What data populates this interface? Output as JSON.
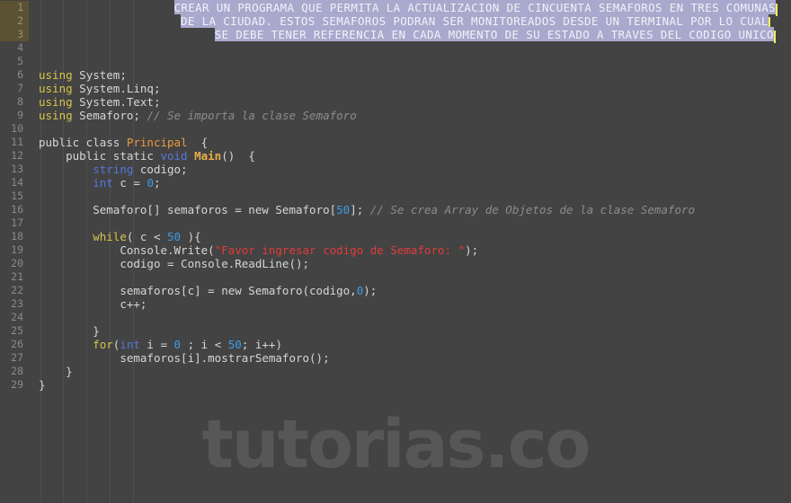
{
  "editor": {
    "background_color": "#434343",
    "gutter_color": "#8a8a8a",
    "highlight_line_bg": "#5b5233",
    "selection_bg": "#a9a8cd",
    "caret_color": "#f5f055",
    "watermark": "tutorias.co"
  },
  "gutter": {
    "numbers": [
      "1",
      "2",
      "3",
      "4",
      "5",
      "6",
      "7",
      "8",
      "9",
      "10",
      "11",
      "12",
      "13",
      "14",
      "15",
      "16",
      "17",
      "18",
      "19",
      "20",
      "21",
      "22",
      "23",
      "24",
      "25",
      "26",
      "27",
      "28",
      "29"
    ]
  },
  "prompt": {
    "line1": "CREAR UN PROGRAMA QUE PERMITA LA ACTUALIZACION DE CINCUENTA SEMAFOROS EN TRES COMUNAS",
    "line2": "DE LA CIUDAD. ESTOS SEMAFOROS PODRAN SER MONITOREADOS DESDE UN TERMINAL POR LO CUAL",
    "line3": "SE DEBE TENER REFERENCIA EN CADA MOMENTO DE SU ESTADO A TRAVES DEL CODIGO UNICO"
  },
  "code": {
    "l6": {
      "kw": "using",
      "rest": " System;"
    },
    "l7": {
      "kw": "using",
      "rest": " System.Linq;"
    },
    "l8": {
      "kw": "using",
      "rest": " System.Text;"
    },
    "l9": {
      "kw": "using",
      "rest": " Semaforo; ",
      "comment": "// Se importa la clase Semaforo"
    },
    "l11": {
      "pre": "public class ",
      "cls": "Principal",
      "post": "  {"
    },
    "l12": {
      "indent": "    ",
      "pre": "public static ",
      "type": "void",
      "mid": " ",
      "fn": "Main",
      "post": "()  {"
    },
    "l13": {
      "indent": "        ",
      "type": "string",
      "rest": " codigo;"
    },
    "l14": {
      "indent": "        ",
      "type": "int",
      "mid": " c = ",
      "num": "0",
      "post": ";"
    },
    "l16": {
      "indent": "        ",
      "pre": "Semaforo[] semaforos = new Semaforo[",
      "num": "50",
      "post": "]; ",
      "comment": "// Se crea Array de Objetos de la clase Semaforo"
    },
    "l18": {
      "indent": "        ",
      "kw": "while",
      "mid": "( c < ",
      "num": "50",
      "post": " ){"
    },
    "l19": {
      "indent": "            ",
      "pre": "Console.Write(",
      "str": "\"Favor ingresar codigo de Semaforo: \"",
      "post": ");"
    },
    "l20": {
      "indent": "            ",
      "rest": "codigo = Console.ReadLine();"
    },
    "l22": {
      "indent": "            ",
      "pre": "semaforos[c] = new Semaforo(codigo,",
      "num": "0",
      "post": ");"
    },
    "l23": {
      "indent": "            ",
      "rest": "c++;"
    },
    "l25": {
      "indent": "        ",
      "rest": "}"
    },
    "l26": {
      "indent": "        ",
      "kw": "for",
      "pre": "(",
      "type": "int",
      "mid": " i = ",
      "num": "0",
      "mid2": " ; i < ",
      "num2": "50",
      "post": "; i++)"
    },
    "l27": {
      "indent": "            ",
      "rest": "semaforos[i].mostrarSemaforo();"
    },
    "l28": {
      "indent": "    ",
      "rest": "}"
    },
    "l29": {
      "indent": "",
      "rest": "}"
    }
  }
}
